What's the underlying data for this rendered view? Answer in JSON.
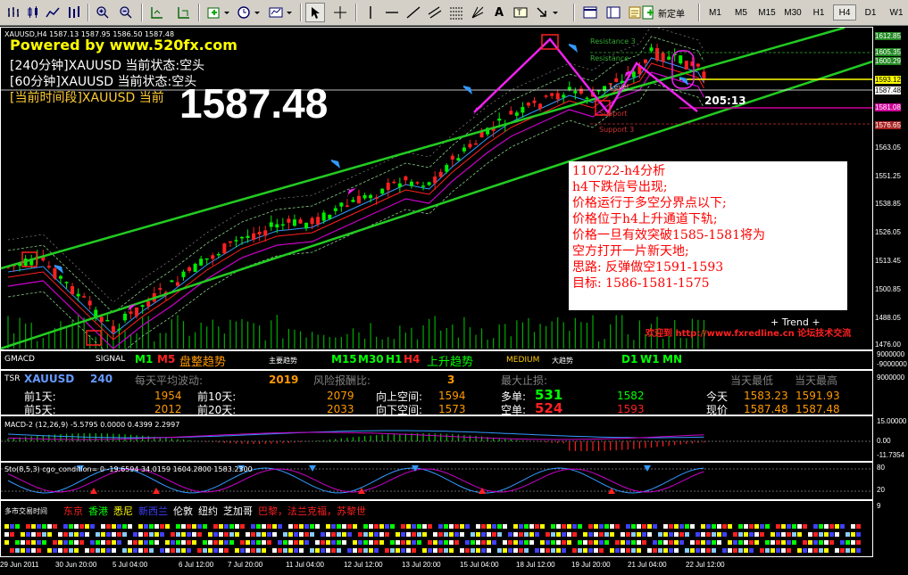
{
  "toolbar": {
    "new_order": "新定单",
    "timeframes": [
      "M1",
      "M5",
      "M15",
      "M30",
      "H1",
      "H4",
      "D1",
      "W1"
    ],
    "active_timeframe": "H4"
  },
  "main": {
    "symbol_line": "XAUUSD,H4  1587.13 1587.95 1586.50 1587.48",
    "powered": "Powered by www.520fx.com",
    "state_lines": [
      "[240分钟]XAUUSD 当前状态:空头",
      "[60分钟]XAUUSD 当前状态:空头",
      "[当前时间段]XAUUSD 当前"
    ],
    "big_price": "1587.48",
    "countdown": "205:13",
    "level_labels": [
      "Resistance 3",
      "Resistance",
      "Level",
      "Support",
      "Support 3"
    ],
    "trend_text": "+ Trend +",
    "watermark": "欢迎到 http://www.fxredline.cn 论坛技术交流",
    "analysis": [
      "110722-h4分析",
      "h4下跌信号出现;",
      "价格运行于多空分界点以下;",
      "价格位于h4上升通道下轨;",
      "价格一旦有效突破1585-1581将为",
      "空方打开一片新天地;",
      "思路: 反弹做空1591-1593",
      "目标: 1586-1581-1575"
    ],
    "price_scale": [
      "1612.85",
      "1605.35",
      "1600.29",
      "1593.12",
      "1587.48",
      "1581.08",
      "1576.65",
      "1563.05",
      "1551.25",
      "1538.85",
      "1526.05",
      "1513.45",
      "1500.85",
      "1488.05",
      "1476.00"
    ],
    "highlight_prices": {
      "yellow": "1593.12",
      "white": "1587.48",
      "magenta": "1581.08"
    }
  },
  "gmacd": {
    "title": "GMACD",
    "signal_label": "SIGNAL",
    "m1": "M1",
    "m5": "M5",
    "state1": "盘整趋势",
    "main_trend": "主要趋势",
    "m15": "M15",
    "m30": "M30",
    "h1": "H1",
    "h4": "H4",
    "state2": "上升趋势",
    "medium": "MEDIUM",
    "big_trend": "大趋势",
    "d1": "D1",
    "w1": "W1",
    "mn": "MN",
    "scale": [
      "9000000",
      "-9000000"
    ]
  },
  "tsr": {
    "name": "TSR",
    "symbol": "XAUUSD",
    "period": "240",
    "avg_label": "每天平均波动:",
    "avg_value": "2019",
    "risk_label": "风险报酬比:",
    "risk_value": "3",
    "maxstop_label": "最大止损:",
    "d1_label": "前1天:",
    "d1": "1954",
    "d10_label": "前10天:",
    "d10": "2079",
    "d5_label": "前5天:",
    "d5": "2012",
    "d20_label": "前20天:",
    "d20": "2033",
    "up_label": "向上空间:",
    "up": "1594",
    "down_label": "向下空间:",
    "down": "1573",
    "long_label": "多单:",
    "long": "531",
    "long_target": "1582",
    "short_label": "空单:",
    "short": "524",
    "short_target": "1593",
    "today_label": "今天",
    "now_label": "现价",
    "low_label": "当天最低",
    "high_label": "当天最高",
    "today_low": "1583.23",
    "today_high": "1591.93",
    "now_low": "1587.48",
    "now_high": "1587.48",
    "scale": [
      "9000000"
    ]
  },
  "macd2": {
    "title": "MACD-2 (12,26,9) -5.5795 0.0000 0.4399 2.2997",
    "scale": [
      "15.00000",
      "0.00",
      "-11.7354"
    ]
  },
  "stoch": {
    "title": "Sto(8,5,3) cgo_condition= 0 -19.6594 34.0159 1604.2800 1583.2300",
    "scale": [
      "80",
      "20"
    ]
  },
  "sessions": {
    "title": "多市交易时间",
    "markets": [
      {
        "name": "东京",
        "color": "#ff2020"
      },
      {
        "name": "香港",
        "color": "#00ff00"
      },
      {
        "name": "悉尼",
        "color": "#ffff00"
      },
      {
        "name": "新西兰",
        "color": "#4040ff"
      },
      {
        "name": "伦敦",
        "color": "#ffffff"
      },
      {
        "name": "纽约",
        "color": "#ffffff"
      },
      {
        "name": "芝加哥",
        "color": "#ffffff"
      },
      {
        "name": "巴黎，法兰克福，苏黎世",
        "color": "#ff2020"
      }
    ],
    "scale": [
      "9"
    ]
  },
  "time_axis": [
    "29 Jun 2011",
    "30 Jun 20:00",
    "5 Jul 04:00",
    "6 Jul 12:00",
    "7 Jul 20:00",
    "11 Jul 04:00",
    "12 Jul 12:00",
    "13 Jul 20:00",
    "15 Jul 04:00",
    "18 Jul 12:00",
    "19 Jul 20:00",
    "21 Jul 04:00",
    "22 Jul 12:00"
  ]
}
